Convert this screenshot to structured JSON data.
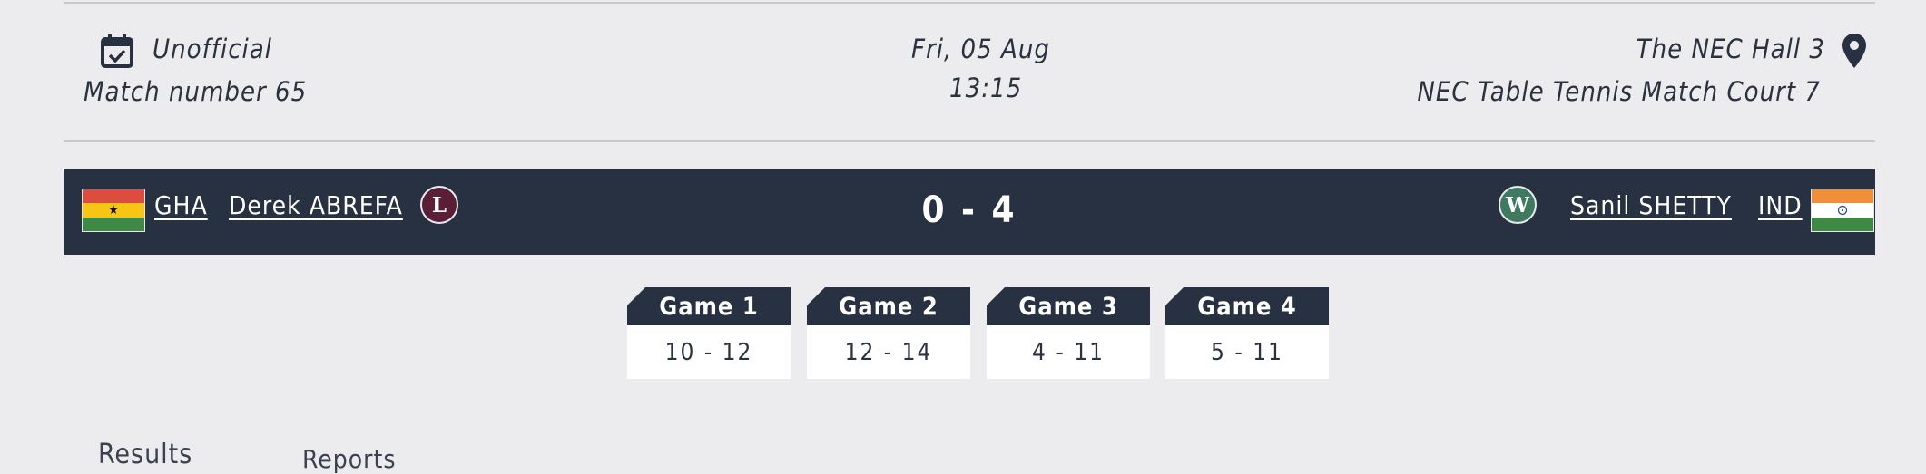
{
  "match_info": {
    "status": "Unofficial",
    "match_number": "Match number 65",
    "date": "Fri, 05 Aug",
    "time": "13:15",
    "venue": "The NEC Hall 3",
    "court": "NEC Table Tennis Match Court 7",
    "icons": {
      "status": "calendar-check-icon",
      "venue": "map-pin-icon"
    }
  },
  "scoreboard": {
    "home": {
      "country_code": "GHA",
      "player": "Derek ABREFA",
      "result": "L",
      "flag": [
        "#de4b3f",
        "#f7c614",
        "#3e8a45"
      ],
      "result_color": "#5a1f37"
    },
    "score": "0 - 4",
    "away": {
      "country_code": "IND",
      "player": "Sanil SHETTY",
      "result": "W",
      "flag": [
        "#ef8f3a",
        "#ffffff",
        "#3e8a45"
      ],
      "result_color": "#3f7a60"
    }
  },
  "games": [
    {
      "label": "Game 1",
      "score": "10 - 12"
    },
    {
      "label": "Game 2",
      "score": "12 - 14"
    },
    {
      "label": "Game 3",
      "score": "4 - 11"
    },
    {
      "label": "Game 4",
      "score": "5 - 11"
    }
  ],
  "tabs": [
    {
      "label": "Results"
    },
    {
      "label": "Reports"
    }
  ],
  "colors": {
    "background": "#ececee",
    "scorebar": "#283141",
    "text": "#2b323f"
  }
}
